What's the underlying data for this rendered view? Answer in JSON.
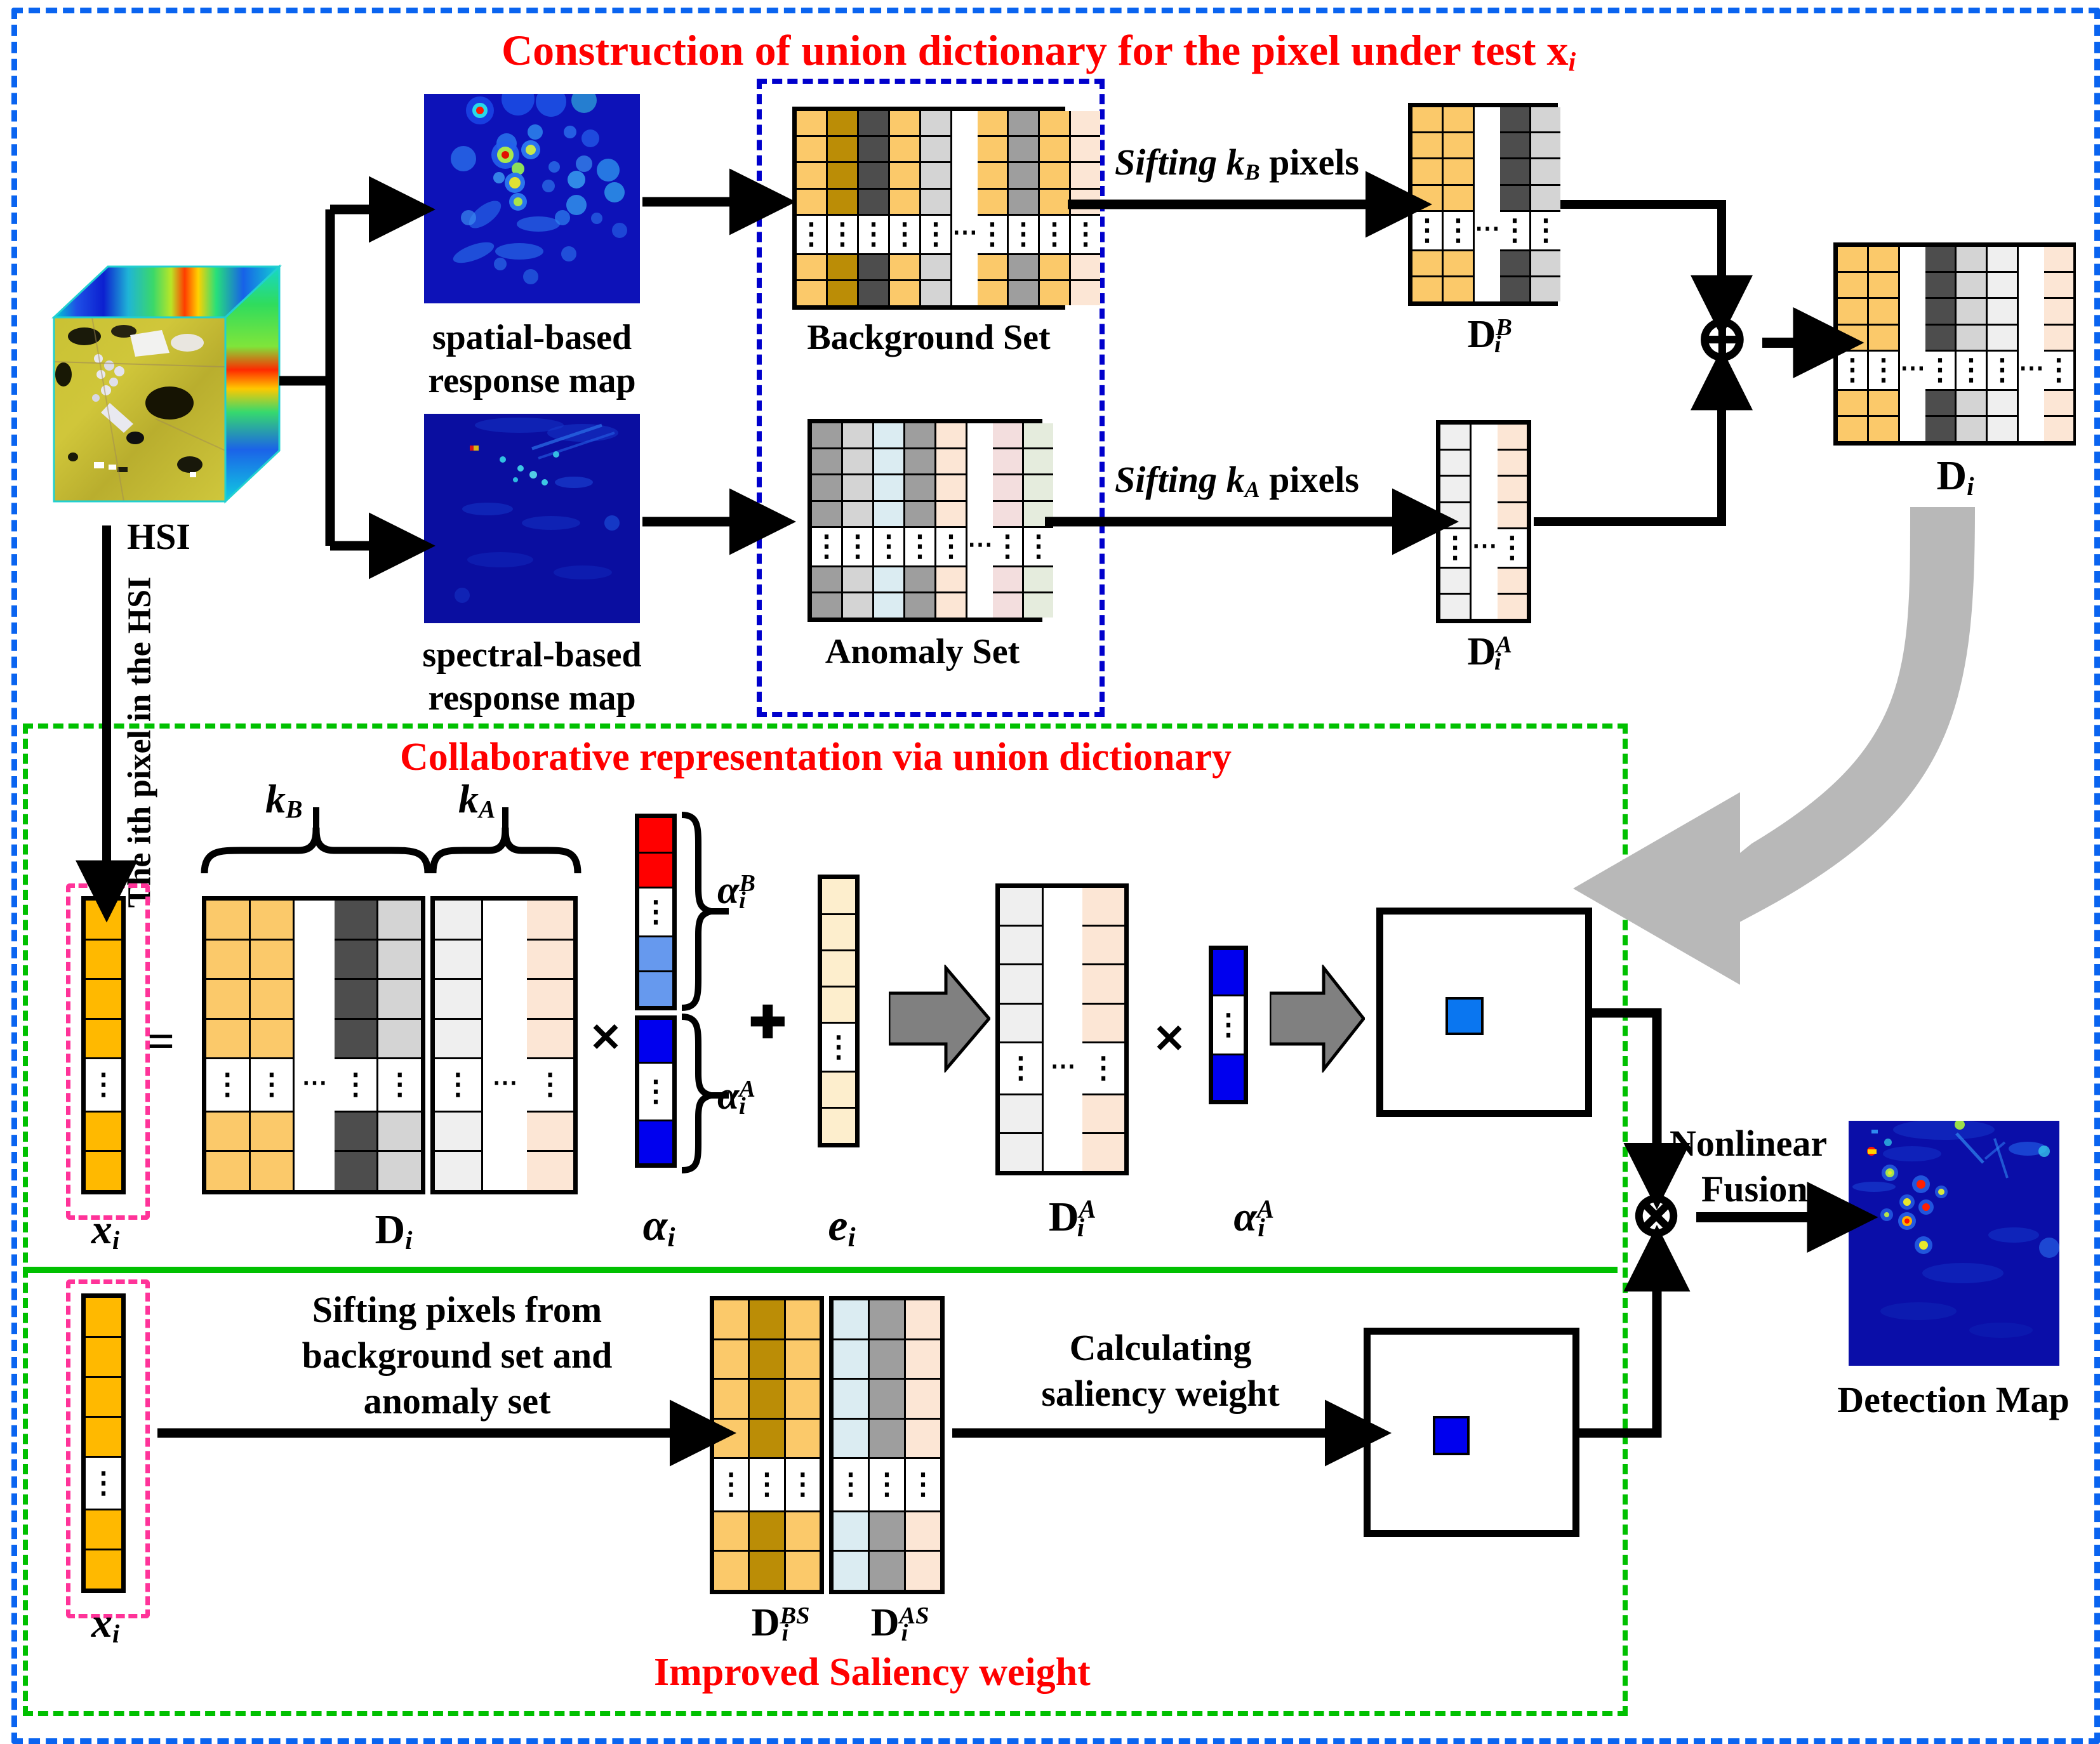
{
  "diagram": {
    "type": "flowchart",
    "sections": [
      {
        "id": "construction",
        "title": "Construction of union dictionary for the pixel under test x",
        "title_sub": "i",
        "border_color": "#0a64f0"
      },
      {
        "id": "collaborative",
        "title": "Collaborative  representation via union dictionary",
        "border_color": "#00c000"
      },
      {
        "id": "saliency",
        "title": "Improved Saliency weight",
        "border_color": "#00c000"
      }
    ]
  },
  "labels": {
    "hsi": "HSI",
    "spatial_map_l1": "spatial-based",
    "spatial_map_l2": "response map",
    "spectral_map_l1": "spectral-based",
    "spectral_map_l2": "response map",
    "background_set": "Background Set",
    "anomaly_set": "Anomaly Set",
    "sifting_kb": "Sifting k",
    "sifting_kb_sub": "B",
    "sifting_kb_tail": " pixels",
    "sifting_ka": "Sifting k",
    "sifting_ka_sub": "A",
    "sifting_ka_tail": " pixels",
    "ith_pixel_l1": "The i",
    "ith_pixel_l2": "th pixel",
    "ith_pixel_l3": "in the HSI",
    "ith_pixel_full": "The ith pixel in the HSI",
    "D_i": "D",
    "D_i_sub": "i",
    "D_iB": "D",
    "D_iB_sub": "i",
    "D_iB_sup": "B",
    "D_iA": "D",
    "D_iA_sub": "i",
    "D_iA_sup": "A",
    "x_i": "x",
    "x_i_sub": "i",
    "k_B": "k",
    "k_B_sub": "B",
    "k_A": "k",
    "k_A_sub": "A",
    "alpha_i": "α",
    "alpha_i_sub": "i",
    "alpha_iB": "α",
    "alpha_iB_sub": "i",
    "alpha_iB_sup": "B",
    "alpha_iA": "α",
    "alpha_iA_sub": "i",
    "alpha_iA_sup": "A",
    "e_i": "e",
    "e_i_sub": "i",
    "D_iBS": "D",
    "D_iBS_sub": "i",
    "D_iBS_sup": "BS",
    "D_iAS": "D",
    "D_iAS_sub": "i",
    "D_iAS_sup": "AS",
    "sifting_pixels_l1": "Sifting pixels from",
    "sifting_pixels_l2": "background set and",
    "sifting_pixels_l3": "anomaly set",
    "calculating_l1": "Calculating",
    "calculating_l2": "saliency weight",
    "nonlinear_l1": "Nonlinear",
    "nonlinear_l2": "Fusion",
    "detection_map": "Detection Map",
    "equals": "=",
    "plus_circle": "⊕",
    "times_circle": "⊗",
    "times": "✕",
    "plus": "✚"
  },
  "colors": {
    "orange_light": "#fbc96a",
    "orange_dark": "#bb8d06",
    "orange_solid": "#ffb900",
    "gray_dark": "#4d4d4d",
    "gray_mid": "#9e9e9e",
    "gray_light": "#d4d4d4",
    "gray_vlight": "#efefef",
    "peach": "#fce6d5",
    "pink_pale": "#f3dede",
    "green_pale": "#e5ecdd",
    "blue_pale": "#dbecf2",
    "cream": "#fdeecd",
    "red": "#ff0000",
    "blue_bright": "#0a64f0",
    "blue_mid": "#6699ee",
    "blue_deep": "#0000ee",
    "green": "#00c000",
    "pink": "#ff3399",
    "gray_arrow": "#b3b3b3"
  },
  "matrices": {
    "background_set": {
      "cols": [
        "#fbc96a",
        "#bb8d06",
        "#4d4d4d",
        "#fbc96a",
        "#d4d4d4",
        "gap",
        "#fbc96a",
        "#9e9e9e",
        "#fbc96a",
        "#fce6d5"
      ],
      "rows": 7,
      "dots_row": 4
    },
    "anomaly_set": {
      "cols": [
        "#9e9e9e",
        "#d4d4d4",
        "#dbecf2",
        "#9e9e9e",
        "#fce6d5",
        "gap",
        "#f3dede",
        "#e5ecdd"
      ],
      "rows": 7,
      "dots_row": 4
    },
    "D_iB": {
      "cols": [
        "#fbc96a",
        "#fbc96a",
        "gap",
        "#4d4d4d",
        "#d4d4d4"
      ],
      "rows": 7,
      "dots_row": 4
    },
    "D_iA": {
      "cols": [
        "#efefef",
        "gap",
        "#fce6d5"
      ],
      "rows": 7,
      "dots_row": 4
    },
    "D_i_top": {
      "cols": [
        "#fbc96a",
        "#fbc96a",
        "gap",
        "#4d4d4d",
        "#d4d4d4",
        "#efefef",
        "gap",
        "#fce6d5"
      ],
      "rows": 7,
      "dots_row": 4
    },
    "D_i_mid_B": {
      "cols": [
        "#fbc96a",
        "#fbc96a",
        "gap",
        "#4d4d4d",
        "#d4d4d4"
      ],
      "rows": 7,
      "dots_row": 4
    },
    "D_i_mid_A": {
      "cols": [
        "#efefef",
        "gap",
        "#fce6d5"
      ],
      "rows": 7,
      "dots_row": 4
    },
    "alpha_B": {
      "cells": [
        "#ff0000",
        "#ff0000",
        "dots",
        "#6699ee",
        "#6699ee"
      ]
    },
    "alpha_A": {
      "cells": [
        "#0000ee",
        "dots",
        "#0000ee"
      ]
    },
    "e_i": {
      "cells": [
        "#fdeecd",
        "#fdeecd",
        "#fdeecd",
        "#fdeecd",
        "dots",
        "#fdeecd",
        "#fdeecd"
      ]
    },
    "alpha_iA_small": {
      "cells": [
        "#0000ee",
        "dots",
        "#0000ee"
      ]
    },
    "x_i_top": {
      "cells": [
        "#ffb900",
        "#ffb900",
        "#ffb900",
        "#ffb900",
        "dots",
        "#ffb900",
        "#ffb900"
      ]
    },
    "x_i_bottom": {
      "cells": [
        "#ffb900",
        "#ffb900",
        "#ffb900",
        "#ffb900",
        "dots",
        "#ffb900",
        "#ffb900"
      ]
    },
    "D_iBS": {
      "cols": [
        "#fbc96a",
        "#bb8d06",
        "#fbc96a"
      ],
      "rows": 7,
      "dots_row": 4
    },
    "D_iAS": {
      "cols": [
        "#dbecf2",
        "#9e9e9e",
        "#fce6d5"
      ],
      "rows": 7,
      "dots_row": 4
    }
  }
}
